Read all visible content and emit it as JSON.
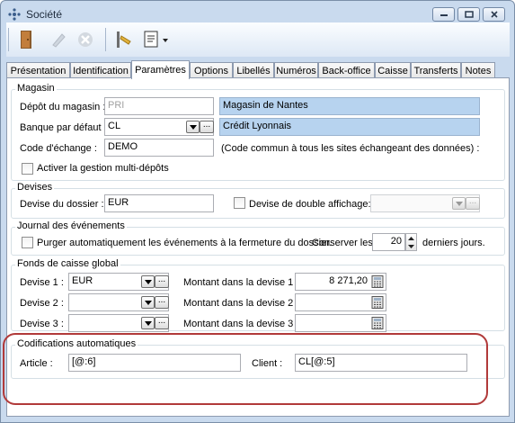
{
  "window": {
    "title": "Société"
  },
  "colors": {
    "highlight": "#b13a3a",
    "field_blue": "#b7d3ef",
    "chrome": "#c9daee"
  },
  "toolbar": {
    "buttons": [
      {
        "icon": "door-exit-icon",
        "enabled": true
      },
      {
        "icon": "pencil-edit-icon",
        "enabled": false
      },
      {
        "icon": "cancel-circle-icon",
        "enabled": false
      },
      {
        "icon": "key-icon",
        "enabled": true
      },
      {
        "icon": "document-list-icon",
        "enabled": true
      }
    ]
  },
  "tabs": [
    {
      "label": "Présentation",
      "active": false
    },
    {
      "label": "Identification",
      "active": false
    },
    {
      "label": "Paramètres",
      "active": true
    },
    {
      "label": "Options",
      "active": false
    },
    {
      "label": "Libellés",
      "active": false
    },
    {
      "label": "Numéros",
      "active": false
    },
    {
      "label": "Back-office",
      "active": false
    },
    {
      "label": "Caisse",
      "active": false
    },
    {
      "label": "Transferts",
      "active": false
    },
    {
      "label": "Notes",
      "active": false
    }
  ],
  "magasin": {
    "legend": "Magasin",
    "depot_label": "Dépôt du magasin :",
    "depot_value": "PRI",
    "depot_name": "Magasin de Nantes",
    "banque_label": "Banque par défaut :",
    "banque_value": "CL",
    "banque_name": "Crédit Lyonnais",
    "code_label": "Code d'échange :",
    "code_value": "DEMO",
    "code_note": "(Code commun à tous les sites échangeant des données) :",
    "multi_depot_label": "Activer la gestion multi-dépôts",
    "multi_depot_checked": false
  },
  "devises": {
    "legend": "Devises",
    "dossier_label": "Devise du dossier :",
    "dossier_value": "EUR",
    "double_label": "Devise de double affichage:",
    "double_checked": false,
    "double_value": ""
  },
  "journal": {
    "legend": "Journal des événements",
    "purge_label": "Purger automatiquement les événements à la fermeture du dossier.",
    "purge_checked": false,
    "conserver_label": "Conserver les :",
    "conserver_value": "20",
    "days_label": "derniers jours."
  },
  "fonds": {
    "legend": "Fonds de caisse global",
    "rows": [
      {
        "devise_label": "Devise 1 :",
        "devise_value": "EUR",
        "montant_label": "Montant dans la devise 1 :",
        "montant_value": "8 271,20"
      },
      {
        "devise_label": "Devise 2 :",
        "devise_value": "",
        "montant_label": "Montant dans la devise 2 :",
        "montant_value": ""
      },
      {
        "devise_label": "Devise 3 :",
        "devise_value": "",
        "montant_label": "Montant dans la devise 3 :",
        "montant_value": ""
      }
    ]
  },
  "codifications": {
    "legend": "Codifications automatiques",
    "article_label": "Article :",
    "article_value": "[@:6]",
    "client_label": "Client :",
    "client_value": "CL[@:5]"
  }
}
